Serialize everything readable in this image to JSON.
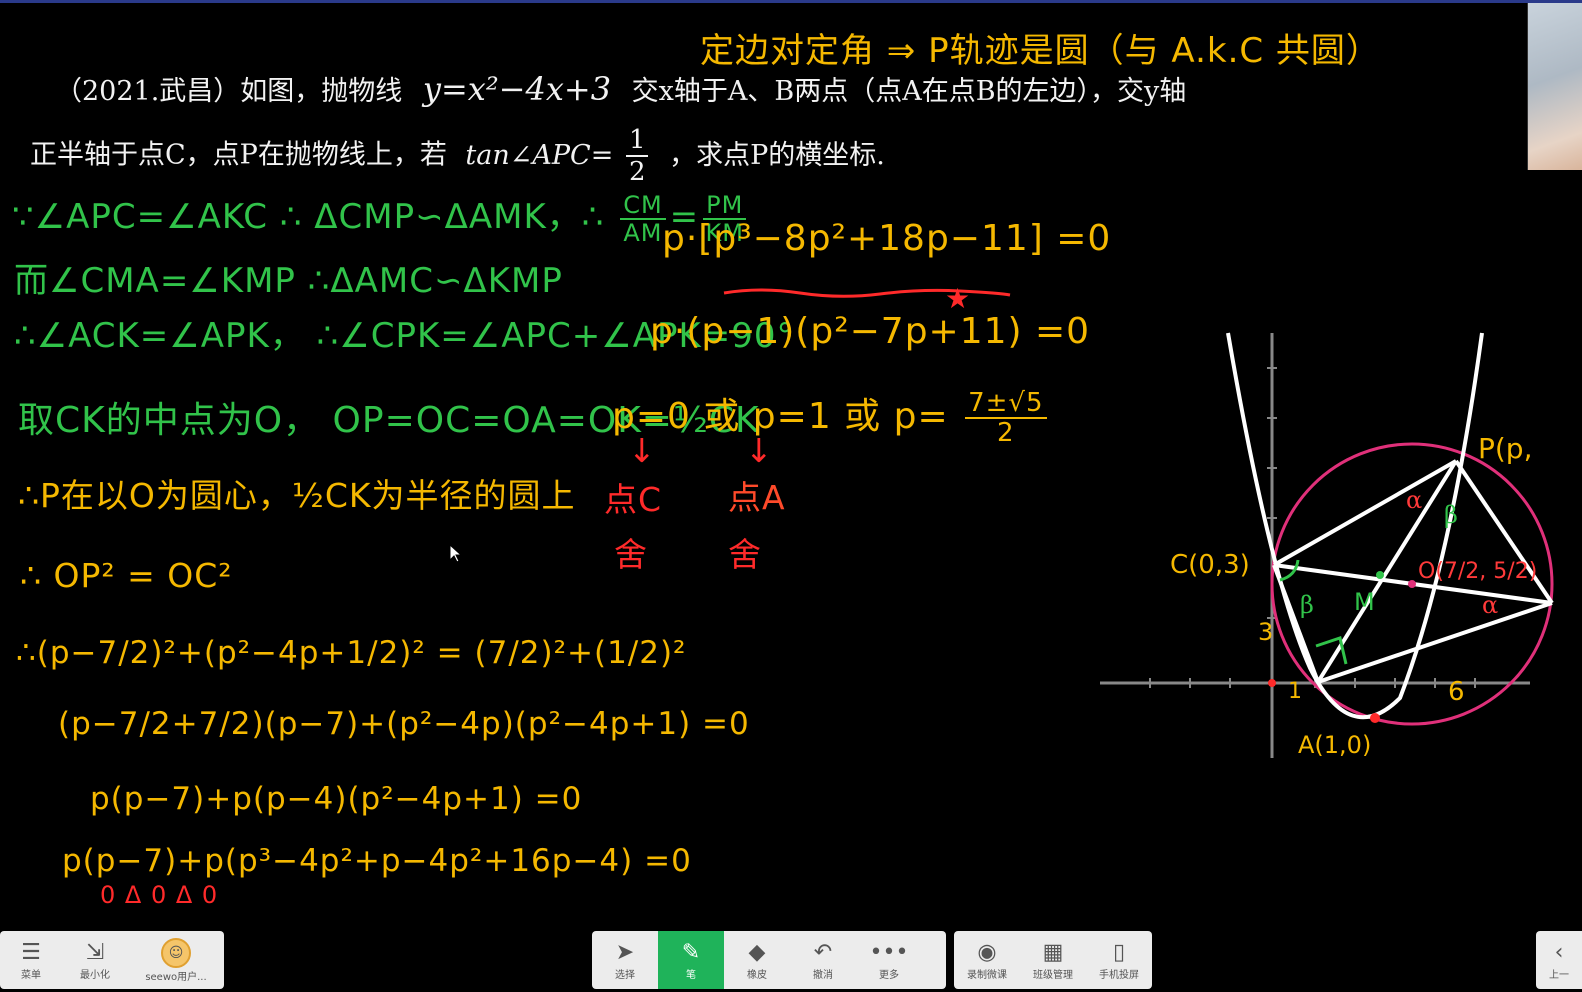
{
  "problem": {
    "line1_prefix": "（2021.武昌）如图，抛物线",
    "equation": "y=x²−4x+3",
    "line1_suffix": "交x轴于A、B两点（点A在点B的左边），交y轴",
    "line2_prefix": "正半轴于点C，点P在抛物线上，若",
    "tan_expr": "tan∠APC=",
    "frac_num": "1",
    "frac_den": "2",
    "line2_suffix": "，求点P的横坐标."
  },
  "notes": {
    "top_right": "定边对定角 ⇒ P轨迹是圆（与 A.k.C 共圆）",
    "g1": "∵∠APC=∠AKC  ∴ ΔCMP∽ΔAMK，∴",
    "g1_frac_num": "CM",
    "g1_frac_den": "AM",
    "g1_frac2_num": "PM",
    "g1_frac2_den": "KM",
    "g2": "而∠CMA=∠KMP   ∴ΔAMC∽ΔKMP",
    "g3": "∴∠ACK=∠APK，  ∴∠CPK=∠APC+∠APK=90°",
    "g4": "取CK的中点为O，  OP=OC=OA=OK=½CK",
    "y1": "∴P在以O为圆心，½CK为半径的圆上",
    "y2": "∴  OP² = OC²",
    "y3": "∴(p−7/2)²+(p²−4p+1/2)² = (7/2)²+(1/2)²",
    "y4": "(p−7/2+7/2)(p−7)+(p²−4p)(p²−4p+1) =0",
    "y5": "p(p−7)+p(p−4)(p²−4p+1) =0",
    "y6": "p(p−7)+p(p³−4p²+p−4p²+16p−4) =0",
    "r1": "0      Δ      0   Δ    0",
    "m1": "p·[p³−8p²+18p−11] =0",
    "m2": "p·(p−1)(p²−7p+11) =0",
    "m3": "p=0 或 p=1  或  p=",
    "m3_frac_num": "7±√5",
    "m3_frac_den": "2",
    "m4a": "点C",
    "m4b": "点A",
    "m5a": "舍",
    "m5b": "舍"
  },
  "graph": {
    "label_C": "C(0,3)",
    "label_A": "A(1,0)",
    "label_O": "O(7/2, 5/2)",
    "label_P": "P(p, ",
    "label_3": "3",
    "label_1": "1",
    "label_6": "6",
    "alpha": "α",
    "beta": "β",
    "m": "M"
  },
  "taskbar": {
    "left": [
      {
        "label": "菜单",
        "icon": "☰"
      },
      {
        "label": "最小化",
        "icon": "⇲"
      },
      {
        "label": "seewo用户...",
        "icon": "avatar"
      }
    ],
    "center": [
      {
        "label": "选择",
        "icon": "➤"
      },
      {
        "label": "笔",
        "icon": "✎"
      },
      {
        "label": "橡皮",
        "icon": "◆"
      },
      {
        "label": "撤消",
        "icon": "↶"
      },
      {
        "label": "更多",
        "icon": "•••"
      }
    ],
    "right": [
      {
        "label": "录制微课",
        "icon": "◉"
      },
      {
        "label": "班级管理",
        "icon": "▦"
      },
      {
        "label": "手机投屏",
        "icon": "▯"
      }
    ],
    "far_right": {
      "label": "上一",
      "icon": "‹"
    }
  }
}
